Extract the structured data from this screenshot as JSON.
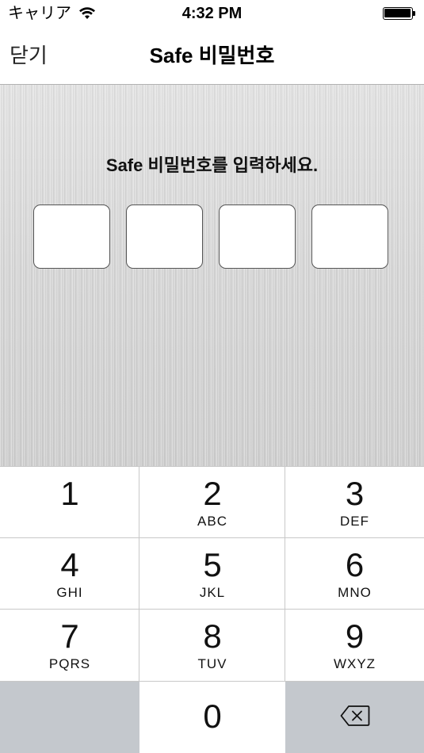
{
  "status_bar": {
    "carrier": "キャリア",
    "wifi_icon": "wifi-icon",
    "time": "4:32 PM",
    "battery_icon": "battery-icon"
  },
  "nav_bar": {
    "close_label": "닫기",
    "title": "Safe 비밀번호"
  },
  "passcode": {
    "prompt": "Safe 비밀번호를 입력하세요.",
    "box_count": 4,
    "entered": ""
  },
  "keypad": {
    "keys": [
      {
        "digit": "1",
        "letters": ""
      },
      {
        "digit": "2",
        "letters": "ABC"
      },
      {
        "digit": "3",
        "letters": "DEF"
      },
      {
        "digit": "4",
        "letters": "GHI"
      },
      {
        "digit": "5",
        "letters": "JKL"
      },
      {
        "digit": "6",
        "letters": "MNO"
      },
      {
        "digit": "7",
        "letters": "PQRS"
      },
      {
        "digit": "8",
        "letters": "TUV"
      },
      {
        "digit": "9",
        "letters": "WXYZ"
      }
    ],
    "zero": {
      "digit": "0"
    },
    "delete_icon": "backspace-icon",
    "colors": {
      "gray_key": "#c4c8cd",
      "divider": "#c8c8c8"
    }
  }
}
